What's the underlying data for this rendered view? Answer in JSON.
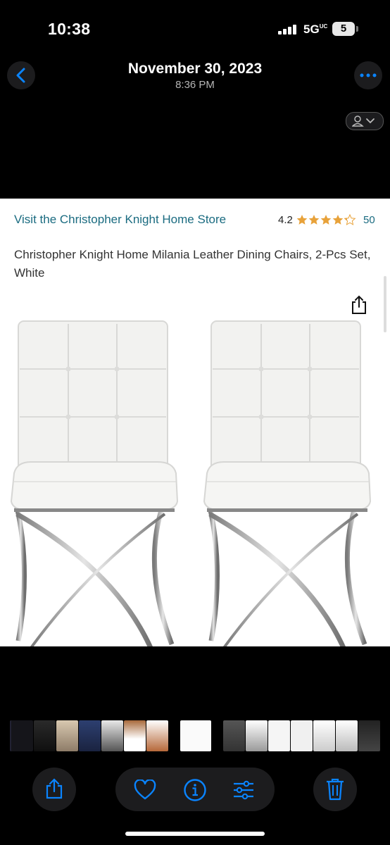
{
  "status": {
    "time": "10:38",
    "network": "5G",
    "network_sup": "UC",
    "battery": "5"
  },
  "header": {
    "date": "November 30, 2023",
    "time": "8:36 PM"
  },
  "product": {
    "store_link": "Visit the Christopher Knight Home Store",
    "rating": "4.2",
    "rating_value": 4.2,
    "review_count": "50",
    "title": "Christopher Knight Home Milania Leather Dining Chairs, 2-Pcs Set, White"
  },
  "icons": {
    "back": "chevron-left-icon",
    "more": "ellipsis-icon",
    "person": "person-chevron-icon",
    "share": "share-icon",
    "favorite": "heart-icon",
    "info": "info-icon",
    "adjust": "sliders-icon",
    "delete": "trash-icon"
  },
  "colors": {
    "accent": "#0a84ff",
    "link": "#1a6b80",
    "star": "#e8a23a"
  }
}
